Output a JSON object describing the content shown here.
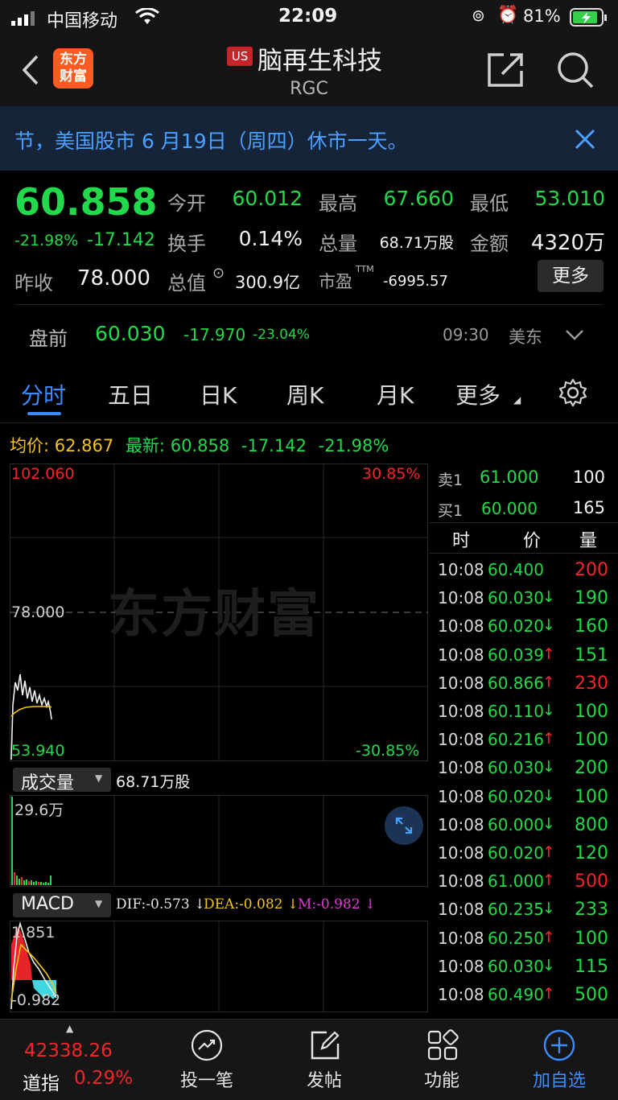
{
  "status": {
    "carrier": "中国移动",
    "time": "22:09",
    "battery": "81%"
  },
  "header": {
    "logo_text": "东方\n财富",
    "market_badge": "US",
    "stock_name": "脑再生科技",
    "ticker": "RGC"
  },
  "notice": {
    "text": "节，美国股市 6 月19日（周四）休市一天。"
  },
  "quote": {
    "price": "60.858",
    "change_pct": "-21.98%",
    "change": "-17.142",
    "prev_close_label": "昨收",
    "prev_close": "78.000",
    "open_label": "今开",
    "open": "60.012",
    "turnover_label": "换手",
    "turnover": "0.14%",
    "mktcap_label": "总值",
    "mktcap": "300.9亿",
    "high_label": "最高",
    "high": "67.660",
    "volume_label": "总量",
    "volume": "68.71万股",
    "pe_label": "市盈",
    "pe_sup": "TTM",
    "pe": "-6995.57",
    "low_label": "最低",
    "low": "53.010",
    "amount_label": "金额",
    "amount": "4320万",
    "more_button": "更多"
  },
  "premarket": {
    "label": "盘前",
    "price": "60.030",
    "change": "-17.970",
    "pct": "-23.04%",
    "time": "09:30",
    "zone": "美东"
  },
  "tabs": [
    "分时",
    "五日",
    "日K",
    "周K",
    "月K",
    "更多"
  ],
  "chart": {
    "avg_label": "均价:",
    "avg": "62.867",
    "latest_label": "最新:",
    "latest": "60.858",
    "chg": "-17.142",
    "pct": "-21.98%",
    "top_price": "102.060",
    "top_pct": "30.85%",
    "mid_price": "78.000",
    "bottom_price": "53.940",
    "bottom_pct": "-30.85%",
    "watermark": "东方财富",
    "vol_label": "成交量",
    "vol_total": "68.71万股",
    "vol_max": "29.6万",
    "macd_label": "MACD",
    "dif": "DIF:-0.573 ↓",
    "dea": "DEA:-0.082 ↓",
    "m": "M:-0.982 ↓",
    "macd_top": "1.851",
    "macd_bottom": "-0.982"
  },
  "orderbook": {
    "sell_label": "卖1",
    "sell_price": "61.000",
    "sell_qty": "100",
    "buy_label": "买1",
    "buy_price": "60.000",
    "buy_qty": "165",
    "col_time": "时",
    "col_price": "价",
    "col_qty": "量"
  },
  "trades": [
    {
      "time": "10:08",
      "price": "60.400",
      "arrow": "",
      "qty": "200",
      "color": "red"
    },
    {
      "time": "10:08",
      "price": "60.030",
      "arrow": "↓",
      "qty": "190",
      "color": "green"
    },
    {
      "time": "10:08",
      "price": "60.020",
      "arrow": "↓",
      "qty": "160",
      "color": "green"
    },
    {
      "time": "10:08",
      "price": "60.039",
      "arrow": "↑",
      "qty": "151",
      "color": "green"
    },
    {
      "time": "10:08",
      "price": "60.866",
      "arrow": "↑",
      "qty": "230",
      "color": "red"
    },
    {
      "time": "10:08",
      "price": "60.110",
      "arrow": "↓",
      "qty": "100",
      "color": "green"
    },
    {
      "time": "10:08",
      "price": "60.216",
      "arrow": "↑",
      "qty": "100",
      "color": "green"
    },
    {
      "time": "10:08",
      "price": "60.030",
      "arrow": "↓",
      "qty": "200",
      "color": "green"
    },
    {
      "time": "10:08",
      "price": "60.020",
      "arrow": "↓",
      "qty": "100",
      "color": "green"
    },
    {
      "time": "10:08",
      "price": "60.000",
      "arrow": "↓",
      "qty": "800",
      "color": "green"
    },
    {
      "time": "10:08",
      "price": "60.020",
      "arrow": "↑",
      "qty": "120",
      "color": "green"
    },
    {
      "time": "10:08",
      "price": "61.000",
      "arrow": "↑",
      "qty": "500",
      "color": "red"
    },
    {
      "time": "10:08",
      "price": "60.235",
      "arrow": "↓",
      "qty": "233",
      "color": "green"
    },
    {
      "time": "10:08",
      "price": "60.250",
      "arrow": "↑",
      "qty": "100",
      "color": "green"
    },
    {
      "time": "10:08",
      "price": "60.030",
      "arrow": "↓",
      "qty": "115",
      "color": "green"
    },
    {
      "time": "10:08",
      "price": "60.490",
      "arrow": "↑",
      "qty": "500",
      "color": "green"
    }
  ],
  "bottom": {
    "index_value": "42338.26",
    "index_name": "道指",
    "index_pct": "0.29%",
    "items": [
      "投一笔",
      "发帖",
      "功能",
      "加自选"
    ]
  }
}
